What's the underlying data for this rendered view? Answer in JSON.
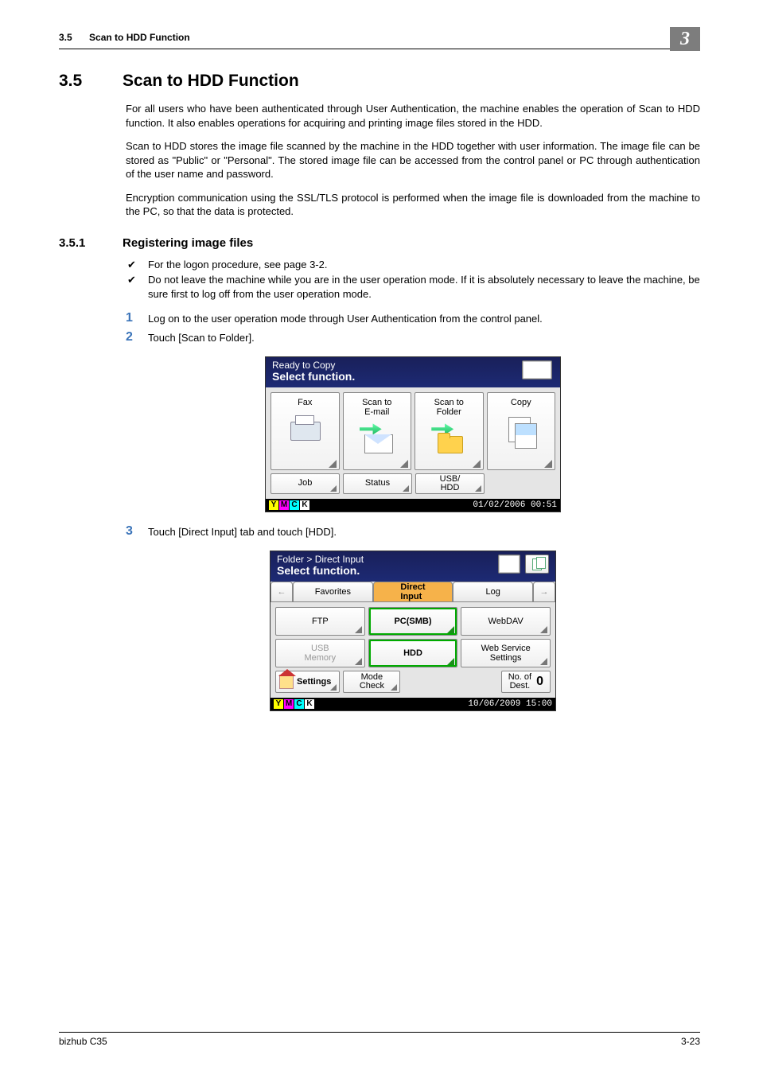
{
  "header": {
    "section_num": "3.5",
    "section_name": "Scan to HDD Function",
    "chapter": "3"
  },
  "title": {
    "num": "3.5",
    "text": "Scan to HDD Function"
  },
  "paragraphs": {
    "p1": "For all users who have been authenticated through User Authentication, the machine enables the operation of Scan to HDD function. It also enables operations for acquiring and printing image files stored in the HDD.",
    "p2": "Scan to HDD stores the image file scanned by the machine in the HDD together with user information. The image file can be stored as \"Public\" or \"Personal\". The stored image file can be accessed from the control panel or PC through authentication of the user name and password.",
    "p3": "Encryption communication using the SSL/TLS protocol is performed when the image file is downloaded from the machine to the PC, so that the data is protected."
  },
  "subsection": {
    "num": "3.5.1",
    "text": "Registering image files"
  },
  "checks": {
    "c1": "For the logon procedure, see page 3-2.",
    "c2": "Do not leave the machine while you are in the user operation mode. If it is absolutely necessary to leave the machine, be sure first to log off from the user operation mode."
  },
  "steps": {
    "s1": "Log on to the user operation mode through User Authentication from the control panel.",
    "s2": "Touch [Scan to Folder].",
    "s3": "Touch [Direct Input] tab and touch [HDD]."
  },
  "screen1": {
    "title_line1": "Ready to Copy",
    "title_line2": "Select function.",
    "tiles": {
      "fax": "Fax",
      "email_l1": "Scan to",
      "email_l2": "E-mail",
      "folder_l1": "Scan to",
      "folder_l2": "Folder",
      "copy": "Copy"
    },
    "row2": {
      "job": "Job",
      "status": "Status",
      "usb_l1": "USB/",
      "usb_l2": "HDD"
    },
    "timestamp": "01/02/2006 00:51"
  },
  "screen2": {
    "title_line1": "Folder > Direct Input",
    "title_line2": "Select function.",
    "tabs": {
      "fav": "Favorites",
      "direct_l1": "Direct",
      "direct_l2": "Input",
      "log": "Log"
    },
    "grid": {
      "ftp": "FTP",
      "pcsmb": "PC(SMB)",
      "webdav": "WebDAV",
      "usb_l1": "USB",
      "usb_l2": "Memory",
      "hdd": "HDD",
      "wss_l1": "Web Service",
      "wss_l2": "Settings"
    },
    "bottom": {
      "settings": "Settings",
      "mode_l1": "Mode",
      "mode_l2": "Check",
      "dest_l1": "No. of",
      "dest_l2": "Dest.",
      "dest_count": "0"
    },
    "timestamp": "10/06/2009 15:00"
  },
  "footer": {
    "left": "bizhub C35",
    "right": "3-23"
  }
}
